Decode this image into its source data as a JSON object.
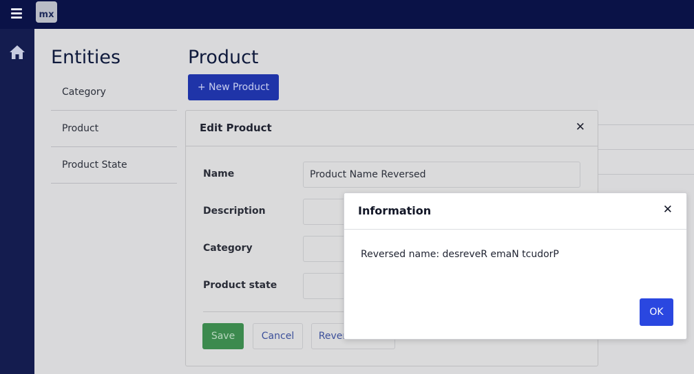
{
  "topbar": {
    "logo_text": "mx",
    "menu_icon": "hamburger-menu-icon"
  },
  "sidenav": {
    "home_icon": "home-icon"
  },
  "entities": {
    "heading": "Entities",
    "items": [
      {
        "label": "Category"
      },
      {
        "label": "Product"
      },
      {
        "label": "Product State"
      }
    ]
  },
  "product": {
    "heading": "Product",
    "new_button_label": "+ New Product"
  },
  "edit_modal": {
    "title": "Edit Product",
    "close_icon": "close-icon",
    "fields": [
      {
        "label": "Name",
        "value": "Product Name Reversed"
      },
      {
        "label": "Description",
        "value": ""
      },
      {
        "label": "Category",
        "value": ""
      },
      {
        "label": "Product state",
        "value": ""
      }
    ],
    "buttons": {
      "save": "Save",
      "cancel": "Cancel",
      "reverse": "Reverse name"
    }
  },
  "info_dialog": {
    "title": "Information",
    "close_icon": "close-icon",
    "message": "Reversed name: desreveR emaN tcudorP",
    "ok_label": "OK"
  },
  "colors": {
    "topbar": "#0a1247",
    "sidenav": "#141c4f",
    "primary": "#2a47e0",
    "success": "#3c8a4e"
  }
}
